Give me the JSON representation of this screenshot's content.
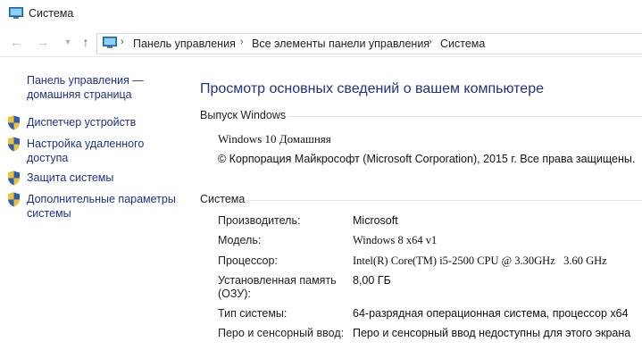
{
  "window": {
    "title": "Система"
  },
  "address": {
    "crumbs": [
      "Панель управления",
      "Все элементы панели управления",
      "Система"
    ],
    "separator": "›"
  },
  "sidebar": {
    "home_link": "Панель управления — домашняя страница",
    "items": [
      {
        "label": "Диспетчер устройств",
        "icon": "shield-icon"
      },
      {
        "label": "Настройка удаленного доступа",
        "icon": "shield-icon"
      },
      {
        "label": "Защита системы",
        "icon": "shield-icon"
      },
      {
        "label": "Дополнительные параметры системы",
        "icon": "shield-icon"
      }
    ]
  },
  "main": {
    "heading": "Просмотр основных сведений о вашем компьютере",
    "edition": {
      "section_title": "Выпуск Windows",
      "name": "Windows 10 Домашняя",
      "copyright": "© Корпорация Майкрософт (Microsoft Corporation), 2015 г. Все права защищены."
    },
    "system": {
      "section_title": "Система",
      "rows": [
        {
          "label": "Производитель:",
          "value": "Microsoft"
        },
        {
          "label": "Модель:",
          "value": "Windows 8 x64 v1"
        },
        {
          "label": "Процессор:",
          "value": "Intel(R) Core(TM) i5-2500 CPU @ 3.30GHz   3.60 GHz"
        },
        {
          "label": "Установленная память (ОЗУ):",
          "value": "8,00 ГБ"
        },
        {
          "label": "Тип системы:",
          "value": "64-разрядная операционная система, процессор x64"
        },
        {
          "label": "Перо и сенсорный ввод:",
          "value": "Перо и сенсорный ввод недоступны для этого экрана"
        }
      ]
    }
  },
  "colors": {
    "link": "#1e3287",
    "shield_blue": "#2b5fb5",
    "shield_yellow": "#f2c12e"
  }
}
